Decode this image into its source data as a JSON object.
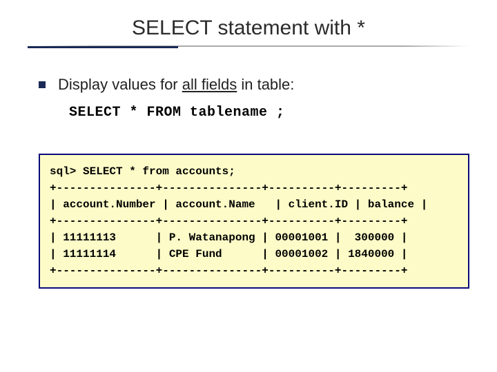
{
  "title": "SELECT statement with *",
  "bullet": {
    "prefix": "Display values for ",
    "underlined": "all fields",
    "suffix": " in table:"
  },
  "code": "SELECT * FROM tablename ;",
  "sql_output": {
    "prompt": "sql> SELECT * from accounts;",
    "sep": "+---------------+---------------+----------+---------+",
    "head": "| account.Number | account.Name   | client.ID | balance |",
    "rows": [
      "| 11111113      | P. Watanapong | 00001001 |  300000 |",
      "| 11111114      | CPE Fund      | 00001002 | 1840000 |"
    ]
  }
}
